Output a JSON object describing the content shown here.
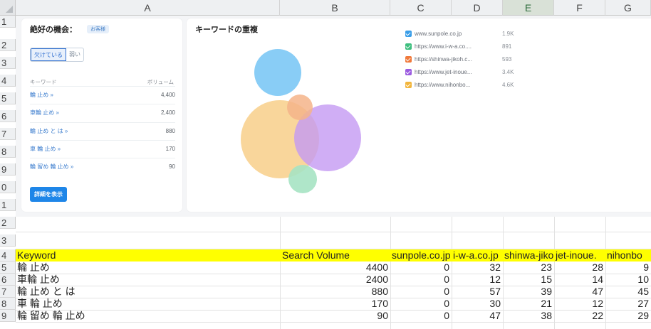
{
  "columns": [
    "A",
    "B",
    "C",
    "D",
    "E",
    "F",
    "G"
  ],
  "selected_column": "E",
  "rows": [
    "1",
    "2",
    "3",
    "4",
    "5",
    "6",
    "7",
    "8",
    "9",
    "0",
    "1",
    "2",
    "3",
    "4",
    "5",
    "6",
    "7",
    "8",
    "9"
  ],
  "dashboard": {
    "left_card": {
      "title": "絶好の機会：",
      "badge": "お客様",
      "toggle_on": "欠けている",
      "toggle_off": "弱い",
      "col_keyword": "キーワード",
      "col_volume": "ボリューム",
      "keywords": [
        {
          "kw": "輪 止め »",
          "vol": "4,400"
        },
        {
          "kw": "車輪 止め »",
          "vol": "2,400"
        },
        {
          "kw": "輪 止め と は »",
          "vol": "880"
        },
        {
          "kw": "車 輪 止め »",
          "vol": "170"
        },
        {
          "kw": "輪 留め 輪 止め »",
          "vol": "90"
        }
      ],
      "details_button": "詳細を表示"
    },
    "right_card": {
      "title": "キーワードの重複",
      "legend": [
        {
          "label": "www.sunpole.co.jp",
          "value": "1.9K",
          "color": "#3a9ee8"
        },
        {
          "label": "https://www.i-w-a.co....",
          "value": "891",
          "color": "#3fbf7f"
        },
        {
          "label": "https://shinwa-jikoh.c...",
          "value": "593",
          "color": "#f07a3c"
        },
        {
          "label": "https://www.jet-inoue...",
          "value": "3.4K",
          "color": "#9b5be0"
        },
        {
          "label": "https://www.nihonbo...",
          "value": "4.6K",
          "color": "#f2b53c"
        }
      ],
      "colors": {
        "blue": "#7cc8f5",
        "orange_small": "#f5b48a",
        "purple": "#c49af2",
        "yellow": "#f8cf8a",
        "green": "#a6e3c3"
      }
    }
  },
  "table": {
    "headers": [
      "Keyword",
      "Search Volume",
      "sunpole.co.jp",
      "i-w-a.co.jp",
      "shinwa-jikoh",
      "jet-inoue.",
      "nihonbo"
    ],
    "rows": [
      [
        "輪 止め",
        "4400",
        "0",
        "32",
        "23",
        "28",
        "9"
      ],
      [
        "車輪 止め",
        "2400",
        "0",
        "12",
        "15",
        "14",
        "10"
      ],
      [
        "輪 止め と は",
        "880",
        "0",
        "57",
        "39",
        "47",
        "45"
      ],
      [
        "車 輪 止め",
        "170",
        "0",
        "30",
        "21",
        "12",
        "27"
      ],
      [
        "輪 留め 輪 止め",
        "90",
        "0",
        "47",
        "38",
        "22",
        "29"
      ]
    ]
  }
}
